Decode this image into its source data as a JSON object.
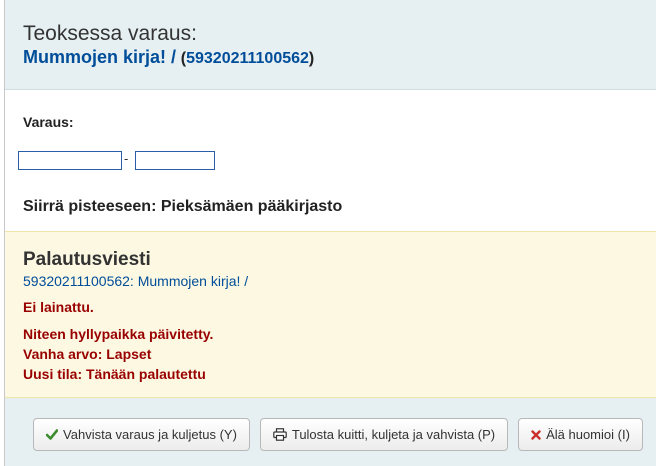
{
  "header": {
    "title": "Teoksessa varaus:",
    "book_title": "Mummojen kirja! /",
    "open_paren": "(",
    "barcode": "59320211100562",
    "close_paren": ")"
  },
  "hold": {
    "label": "Varaus:",
    "date_from_value": "",
    "date_to_value": "",
    "separator": "-",
    "transfer_text": "Siirrä pisteeseen: Pieksämäen pääkirjasto"
  },
  "return_message": {
    "title": "Palautusviesti",
    "item_link": "59320211100562: Mummojen kirja! /",
    "messages": [
      "Ei lainattu.",
      "Niteen hyllypaikka päivitetty.",
      "Vanha arvo: Lapset",
      "Uusi tila: Tänään palautettu"
    ]
  },
  "buttons": {
    "confirm": "Vahvista varaus ja kuljetus (Y)",
    "print": "Tulosta kuitti, kuljeta ja vahvista (P)",
    "ignore": "Älä huomioi (I)"
  },
  "icons": {
    "confirm": "check-icon",
    "print": "print-icon",
    "ignore": "close-icon"
  },
  "colors": {
    "header_bg": "#e6f0f2",
    "link": "#004d99",
    "alert_bg": "#fcf8e2",
    "alert_text": "#990000",
    "check_green": "#3d8c2f",
    "close_red": "#c9302c"
  }
}
